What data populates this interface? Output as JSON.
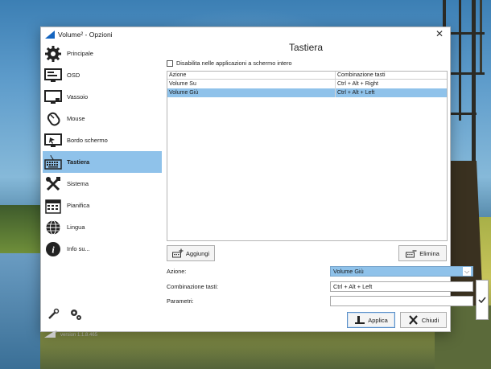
{
  "window": {
    "title": "Volume² - Opzioni",
    "close_glyph": "✕"
  },
  "sidebar": {
    "items": [
      {
        "label": "Principale",
        "icon": "gear-icon"
      },
      {
        "label": "OSD",
        "icon": "monitor-icon"
      },
      {
        "label": "Vassoio",
        "icon": "tray-monitor-icon"
      },
      {
        "label": "Mouse",
        "icon": "mouse-icon"
      },
      {
        "label": "Bordo schermo",
        "icon": "screen-edge-icon"
      },
      {
        "label": "Tastiera",
        "icon": "keyboard-icon"
      },
      {
        "label": "Sistema",
        "icon": "tools-icon"
      },
      {
        "label": "Pianifica",
        "icon": "calendar-icon"
      },
      {
        "label": "Lingua",
        "icon": "globe-icon"
      },
      {
        "label": "Info su...",
        "icon": "info-icon"
      }
    ],
    "active_index": 5,
    "version": "version 1.1.8.465",
    "version_badge": "2"
  },
  "main": {
    "title": "Tastiera",
    "disable_fullscreen_label": "Disabilita nelle applicazioni a schermo intero",
    "disable_fullscreen_checked": false,
    "table": {
      "headers": [
        "Azione",
        "Combinazione tasti"
      ],
      "rows": [
        {
          "action": "Volume Su",
          "combo": "Ctrl + Alt + Right",
          "selected": false
        },
        {
          "action": "Volume Giù",
          "combo": "Ctrl + Alt + Left",
          "selected": true
        }
      ]
    },
    "add_button": "Aggiungi",
    "delete_button": "Elimina",
    "form": {
      "action_label": "Azione:",
      "action_value": "Volume Giù",
      "combo_label": "Combinazione tasti:",
      "combo_value": "Ctrl + Alt + Left",
      "params_label": "Parametri:",
      "params_value": ""
    },
    "apply_button": "Applica",
    "close_button": "Chiudi"
  },
  "colors": {
    "selection": "#8fc2ea",
    "accent": "#1565c0"
  }
}
